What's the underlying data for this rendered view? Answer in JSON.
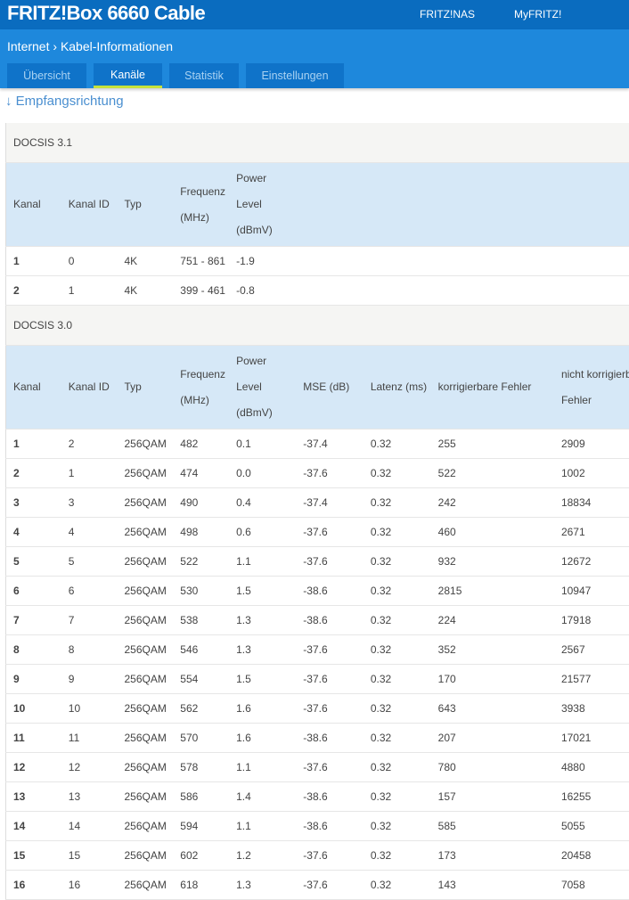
{
  "header": {
    "title": "FRITZ!Box 6660 Cable",
    "links": [
      "FRITZ!NAS",
      "MyFRITZ!"
    ]
  },
  "breadcrumb": {
    "parent": "Internet",
    "separator": "›",
    "current": "Kabel-Informationen"
  },
  "tabs": [
    "Übersicht",
    "Kanäle",
    "Statistik",
    "Einstellungen"
  ],
  "direction": "↓ Empfangsrichtung",
  "docsis31": {
    "title": "DOCSIS 3.1",
    "columns": [
      "Kanal",
      "Kanal ID",
      "Typ",
      "Frequenz (MHz)",
      "Power Level (dBmV)"
    ],
    "rows": [
      [
        "1",
        "0",
        "4K",
        "751 - 861",
        "-1.9"
      ],
      [
        "2",
        "1",
        "4K",
        "399 - 461",
        "-0.8"
      ]
    ]
  },
  "docsis30": {
    "title": "DOCSIS 3.0",
    "columns": [
      "Kanal",
      "Kanal ID",
      "Typ",
      "Frequenz (MHz)",
      "Power Level (dBmV)",
      "MSE (dB)",
      "Latenz (ms)",
      "korrigierbare Fehler",
      "nicht korrigierbare Fehler"
    ],
    "rows": [
      [
        "1",
        "2",
        "256QAM",
        "482",
        "0.1",
        "-37.4",
        "0.32",
        "255",
        "2909"
      ],
      [
        "2",
        "1",
        "256QAM",
        "474",
        "0.0",
        "-37.6",
        "0.32",
        "522",
        "1002"
      ],
      [
        "3",
        "3",
        "256QAM",
        "490",
        "0.4",
        "-37.4",
        "0.32",
        "242",
        "18834"
      ],
      [
        "4",
        "4",
        "256QAM",
        "498",
        "0.6",
        "-37.6",
        "0.32",
        "460",
        "2671"
      ],
      [
        "5",
        "5",
        "256QAM",
        "522",
        "1.1",
        "-37.6",
        "0.32",
        "932",
        "12672"
      ],
      [
        "6",
        "6",
        "256QAM",
        "530",
        "1.5",
        "-38.6",
        "0.32",
        "2815",
        "10947"
      ],
      [
        "7",
        "7",
        "256QAM",
        "538",
        "1.3",
        "-38.6",
        "0.32",
        "224",
        "17918"
      ],
      [
        "8",
        "8",
        "256QAM",
        "546",
        "1.3",
        "-37.6",
        "0.32",
        "352",
        "2567"
      ],
      [
        "9",
        "9",
        "256QAM",
        "554",
        "1.5",
        "-37.6",
        "0.32",
        "170",
        "21577"
      ],
      [
        "10",
        "10",
        "256QAM",
        "562",
        "1.6",
        "-37.6",
        "0.32",
        "643",
        "3938"
      ],
      [
        "11",
        "11",
        "256QAM",
        "570",
        "1.6",
        "-38.6",
        "0.32",
        "207",
        "17021"
      ],
      [
        "12",
        "12",
        "256QAM",
        "578",
        "1.1",
        "-37.6",
        "0.32",
        "780",
        "4880"
      ],
      [
        "13",
        "13",
        "256QAM",
        "586",
        "1.4",
        "-38.6",
        "0.32",
        "157",
        "16255"
      ],
      [
        "14",
        "14",
        "256QAM",
        "594",
        "1.1",
        "-38.6",
        "0.32",
        "585",
        "5055"
      ],
      [
        "15",
        "15",
        "256QAM",
        "602",
        "1.2",
        "-37.6",
        "0.32",
        "173",
        "20458"
      ],
      [
        "16",
        "16",
        "256QAM",
        "618",
        "1.3",
        "-37.6",
        "0.32",
        "143",
        "7058"
      ]
    ]
  }
}
